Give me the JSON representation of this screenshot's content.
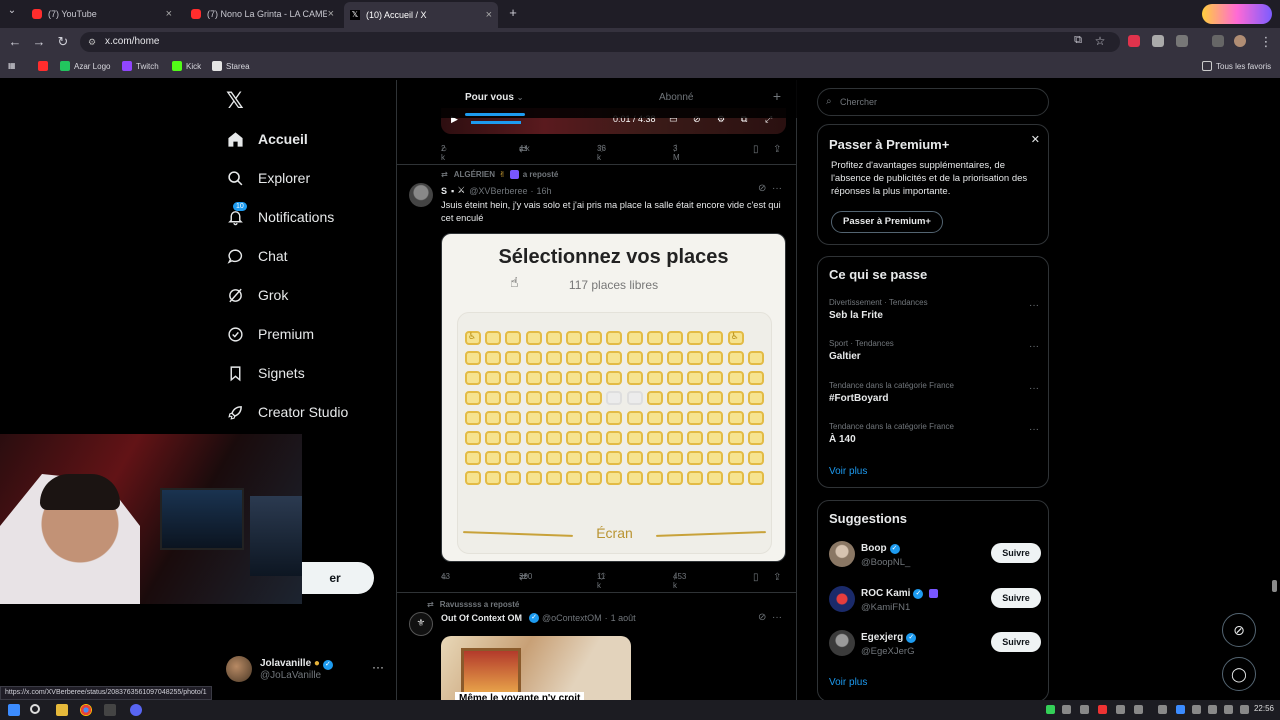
{
  "browser": {
    "tabs": [
      {
        "title": "(7) YouTube",
        "type": "youtube"
      },
      {
        "title": "(7) Nono La Grinta - LA CAME",
        "type": "youtube"
      },
      {
        "title": "(10) Accueil / X",
        "type": "x",
        "active": true
      }
    ],
    "url": "x.com/home",
    "bookmarks": [
      {
        "label": "Azar Logo",
        "color": "#22c55e"
      },
      {
        "label": "Twitch",
        "color": "#9146ff"
      },
      {
        "label": "Kick",
        "color": "#53fc18"
      },
      {
        "label": "Starea",
        "color": "#e5e5e5"
      }
    ],
    "all_bookmarks": "Tous les favoris",
    "status_url": "https://x.com/XVBerberee/status/2083763561097048255/photo/1"
  },
  "nav": {
    "items": [
      {
        "label": "Accueil",
        "icon": "home-icon",
        "bold": true
      },
      {
        "label": "Explorer",
        "icon": "search-icon"
      },
      {
        "label": "Notifications",
        "icon": "bell-icon",
        "badge": "10"
      },
      {
        "label": "Chat",
        "icon": "chat-icon"
      },
      {
        "label": "Grok",
        "icon": "grok-icon"
      },
      {
        "label": "Premium",
        "icon": "premium-icon"
      },
      {
        "label": "Signets",
        "icon": "bookmark-icon"
      },
      {
        "label": "Creator Studio",
        "icon": "rocket-icon"
      }
    ],
    "post_partial": "er",
    "account": {
      "name": "Jolavanille",
      "handle": "@JoLaVanille"
    }
  },
  "feed": {
    "tabs": {
      "for_you": "Pour vous",
      "following": "Abonné"
    },
    "video_time": "0:01 / 4:38",
    "tweet1_actions": {
      "replies": "2 k",
      "reposts": "4 k",
      "likes": "36 k",
      "views": "3 M"
    },
    "tweet2": {
      "repost_by": "ALGÉRIEN",
      "repost_suffix": "a reposté",
      "name": "S",
      "handle": "@XVBerberee",
      "time": "16h",
      "text": "Jsuis éteint hein, j'y vais solo et j'ai pris ma place la salle était encore vide c'est qui cet enculé",
      "image": {
        "title": "Sélectionnez vos places",
        "subtitle": "117 places libres",
        "screen": "Écran"
      },
      "actions": {
        "replies": "43",
        "reposts": "300",
        "likes": "11 k",
        "views": "453 k"
      }
    },
    "tweet3": {
      "repost_by": "Ravusssss a reposté",
      "name": "Out Of Context OM",
      "handle": "@oContextOM",
      "time": "1 août",
      "caption": "Même le voyante n'y croit"
    }
  },
  "right": {
    "search_placeholder": "Chercher",
    "premium": {
      "title": "Passer à Premium+",
      "text": "Profitez d'avantages supplémentaires, de l'absence de publicités et de la priorisation des réponses la plus importante.",
      "button": "Passer à Premium+"
    },
    "trends": {
      "title": "Ce qui se passe",
      "items": [
        {
          "category": "Divertissement · Tendances",
          "title": "Seb la Frite"
        },
        {
          "category": "Sport · Tendances",
          "title": "Galtier"
        },
        {
          "category": "Tendance dans la catégorie France",
          "title": "#FortBoyard"
        },
        {
          "category": "Tendance dans la catégorie France",
          "title": "À 140"
        }
      ],
      "see_more": "Voir plus"
    },
    "suggestions": {
      "title": "Suggestions",
      "items": [
        {
          "name": "Boop",
          "handle": "@BoopNL_",
          "follow": "Suivre"
        },
        {
          "name": "ROC Kami",
          "handle": "@KamiFN1",
          "follow": "Suivre"
        },
        {
          "name": "Egexjerg",
          "handle": "@EgeXJerG",
          "follow": "Suivre"
        }
      ],
      "see_more": "Voir plus"
    }
  },
  "taskbar": {
    "time": "22:56"
  },
  "colors": {
    "accent": "#1d9bf0",
    "bg": "#000000",
    "border": "#2f3336",
    "muted": "#71767b",
    "seat": "#f6e38f"
  }
}
